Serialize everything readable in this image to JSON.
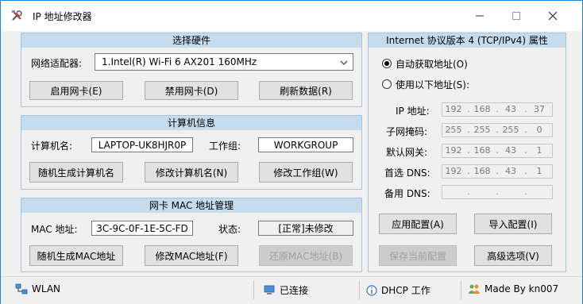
{
  "window": {
    "title": "IP 地址修改器",
    "icon": "tools-icon",
    "controls": [
      "minimize",
      "maximize",
      "close"
    ]
  },
  "hardware": {
    "header": "选择硬件",
    "adapter_label": "网络适配器:",
    "adapter_value": "1.Intel(R) Wi-Fi 6 AX201 160MHz",
    "enable_label": "启用网卡(E)",
    "disable_label": "禁用网卡(D)",
    "refresh_label": "刷新数据(R)"
  },
  "computer": {
    "header": "计算机信息",
    "name_label": "计算机名:",
    "name_value": "LAPTOP-UK8HJR0P",
    "workgroup_label": "工作组:",
    "workgroup_value": "WORKGROUP",
    "random_name_label": "随机生成计算机名",
    "modify_name_label": "修改计算机名(N)",
    "modify_workgroup_label": "修改工作组(W)"
  },
  "mac": {
    "header": "网卡 MAC 地址管理",
    "mac_label": "MAC 地址:",
    "mac_value": "3C-9C-0F-1E-5C-FD",
    "status_label": "状态:",
    "status_value": "[正常]未修改",
    "random_mac_label": "随机生成MAC地址",
    "modify_mac_label": "修改MAC地址(F)",
    "restore_mac_label": "还原MAC地址(B)"
  },
  "ipv4": {
    "header": "Internet 协议版本 4 (TCP/IPv4) 属性",
    "auto_label": "自动获取地址(O)",
    "manual_label": "使用以下地址(S):",
    "selected": "auto",
    "ip_label": "IP 地址:",
    "ip": [
      "192",
      "168",
      "43",
      "37"
    ],
    "mask_label": "子网掩码:",
    "mask": [
      "255",
      "255",
      "255",
      "0"
    ],
    "gateway_label": "默认网关:",
    "gateway": [
      "192",
      "168",
      "43",
      "1"
    ],
    "dns1_label": "首选 DNS:",
    "dns1": [
      "192",
      "168",
      "43",
      "1"
    ],
    "dns2_label": "备用 DNS:",
    "dns2": [
      "",
      "",
      "",
      ""
    ],
    "apply_label": "应用配置(A)",
    "import_label": "导入配置(I)",
    "save_label": "保存当前配置",
    "advanced_label": "高级选项(V)"
  },
  "statusbar": {
    "network": "WLAN",
    "connection": "已连接",
    "dhcp": "DHCP 工作",
    "author": "Made By kn007"
  }
}
